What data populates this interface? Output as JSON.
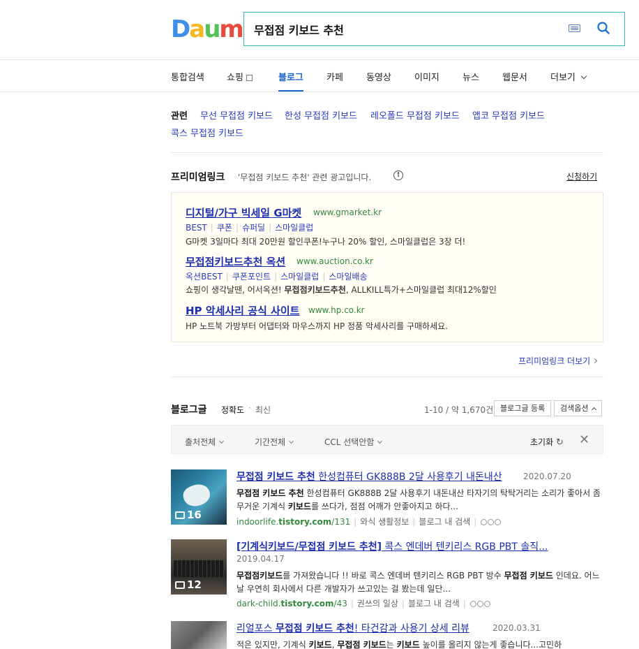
{
  "logo": {
    "letters": [
      "D",
      "a",
      "u",
      "m"
    ],
    "colors": [
      "#3f8ee8",
      "#f5b823",
      "#55c05a",
      "#e94a3c"
    ]
  },
  "search": {
    "value": "무접점 키보드 추천"
  },
  "tabs": [
    {
      "label": "통합검색",
      "active": false
    },
    {
      "label": "쇼핑",
      "active": false
    },
    {
      "label": "블로그",
      "active": true
    },
    {
      "label": "카페",
      "active": false
    },
    {
      "label": "동영상",
      "active": false
    },
    {
      "label": "이미지",
      "active": false
    },
    {
      "label": "뉴스",
      "active": false
    },
    {
      "label": "웹문서",
      "active": false
    },
    {
      "label": "더보기",
      "active": false
    }
  ],
  "related": {
    "label": "관련",
    "items": [
      "무선 무접점 키보드",
      "한성 무접점 키보드",
      "레오폴드 무접점 키보드",
      "앱코 무접점 키보드",
      "콕스 무접점 키보드"
    ]
  },
  "premium": {
    "title": "프리미엄링크",
    "query_note": "'무접점 키보드 추천' 관련 광고입니다.",
    "apply": "신청하기",
    "more": "프리미엄링크 더보기",
    "ads": [
      {
        "title": "디지털/가구 빅세일 G마켓",
        "url": "www.gmarket.kr",
        "subs": [
          "BEST",
          "쿠폰",
          "슈퍼딜",
          "스마일클럽"
        ],
        "desc": "G마켓 3일마다 최대 20만원 할인쿠폰!누구나 20% 할인, 스마일클럽은 3장 더!"
      },
      {
        "title": "무접점키보드추천 옥션",
        "url": "www.auction.co.kr",
        "subs": [
          "옥션BEST",
          "쿠폰포인트",
          "스마일클럽",
          "스마일배송"
        ],
        "desc_pre": "쇼핑이 생각날땐, 어서옥션! ",
        "desc_bold": "무접점키보드추천",
        "desc_post": ", ALLKILL특가+스마일클럽 최대12%할인"
      },
      {
        "title": "HP 악세사리 공식 사이트",
        "url": "www.hp.co.kr",
        "subs": [],
        "desc": "HP 노트북 가방부터 어댑터와 마우스까지 HP 정품 악세사리를 구매하세요."
      }
    ]
  },
  "blog": {
    "title": "블로그글",
    "sort_accuracy": "정확도",
    "sort_recent": "최신",
    "count": "1-10 / 약 1,670건",
    "register_btn": "블로그글 등록",
    "options_btn": "검색옵션",
    "filters": {
      "source": "출처전체",
      "period": "기간전체",
      "ccl": "CCL 선택안함",
      "reset": "초기화"
    },
    "results": [
      {
        "title_bold": "무접점 키보드 추천",
        "title_rest": " 한성컴퓨터 GK888B 2달 사용후기 내돈내산",
        "date": "2020.07.20",
        "img_count": "16",
        "desc_html": "<b>무접점 키보드 추천</b> 한성컴퓨터 GK888B 2달 사용후기 내돈내산 타자기의 탁탁거리는 소리가 좋아서 좀 무거운 기계식 <b>키보드</b>를 쓰다가, 점점 어깨가 안좋아지고 하다...",
        "url_pre": "indoorlife.",
        "url_bold": "tistory.com",
        "url_post": "/131",
        "category": "와식 생활정보",
        "in_blog": "블로그 내 검색"
      },
      {
        "title_bold": "[기계식키보드/무접점 키보드 추천]",
        "title_rest": " 콕스 엔데버 텐키리스 RGB PBT 솔직...",
        "date": "2019.04.17",
        "img_count": "12",
        "desc_html": "<b>무접점키보드</b>를 가져왔습니다 !! 바로 콕스 엔데버 텐키리스 RGB PBT 방수 <b>무접점 키보드</b> 인데요. 어느날 우연히 회사에서 다른 개발자가 쓰고있는 걸 봤는데 일단...",
        "url_pre": "dark-child.",
        "url_bold": "tistory.com",
        "url_post": "/43",
        "category": "권쓰의 일상",
        "in_blog": "블로그 내 검색"
      },
      {
        "title_pre": "리얼포스 ",
        "title_bold": "무접점 키보드 추천",
        "title_rest": "! 타건감과 사용기 상세 리뷰",
        "date": "2020.03.31",
        "desc_html": "적은 있지만, 기계식 <b>키보드</b>, <b>무접점 키보드</b>는 <b>키보드</b> 높이를 올리지 않는게 좋습니다...고민하"
      }
    ]
  }
}
